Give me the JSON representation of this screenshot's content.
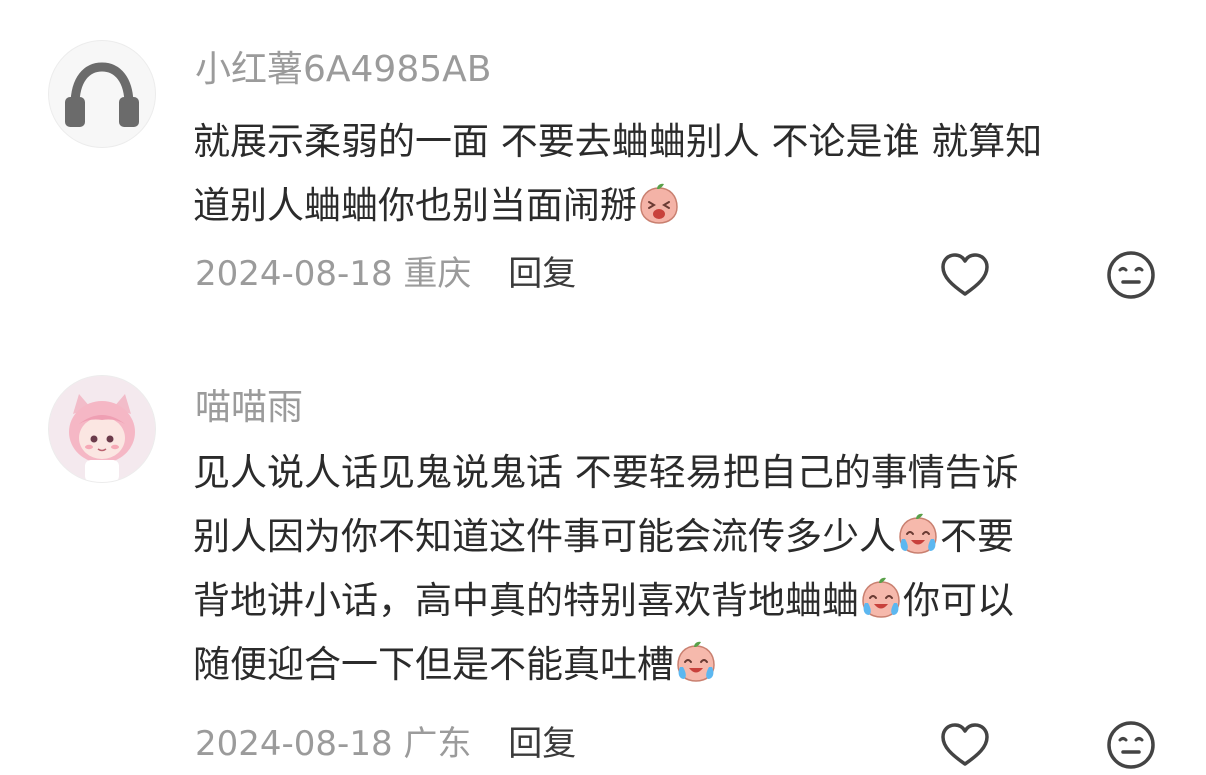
{
  "comments": [
    {
      "username": "小红薯6A4985AB",
      "avatar_icon": "headphones-icon",
      "lines": [
        "就展示柔弱的一面 不要去蛐蛐别人 不论是谁 就算知",
        "道别人蛐蛐你也别当面闹掰"
      ],
      "date": "2024-08-18",
      "location": "重庆",
      "reply_label": "回复",
      "emojis": [
        "crying-face-emoji"
      ]
    },
    {
      "username": "喵喵雨",
      "avatar_icon": "pink-anime-avatar",
      "lines": [
        "见人说人话见鬼说鬼话 不要轻易把自己的事情告诉",
        "别人因为你不知道这件事可能会流传多少人",
        "不要",
        "背地讲小话，高中真的特别喜欢背地蛐蛐",
        "你可以",
        "随便迎合一下但是不能真吐槽"
      ],
      "date": "2024-08-18",
      "location": "广东",
      "reply_label": "回复",
      "emojis": [
        "tears-of-joy-emoji",
        "tears-of-joy-emoji",
        "tears-of-joy-emoji"
      ]
    }
  ],
  "colors": {
    "username": "#9b9b9b",
    "body": "#2b2b2b",
    "meta": "#9b9b9b",
    "reply": "#3a3a3a",
    "icon": "#444444"
  }
}
